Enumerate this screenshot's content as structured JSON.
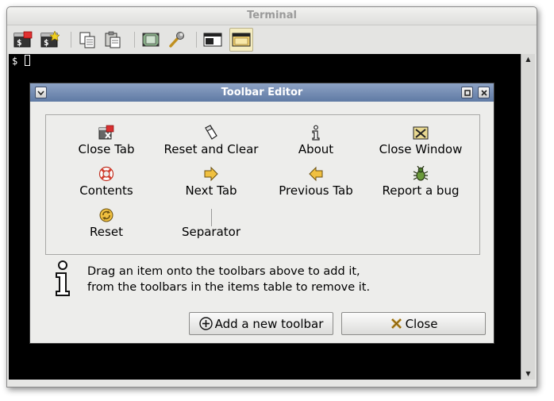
{
  "terminal": {
    "title": "Terminal",
    "prompt": "$",
    "toolbar": {
      "buttons": [
        {
          "name": "new-tab-icon",
          "active": false
        },
        {
          "name": "new-window-icon",
          "active": false
        },
        {
          "name": "copy-icon",
          "active": false
        },
        {
          "name": "paste-icon",
          "active": false
        },
        {
          "name": "fullscreen-icon",
          "active": false
        },
        {
          "name": "wrench-icon",
          "active": false
        },
        {
          "name": "window-icon",
          "active": false
        },
        {
          "name": "toolbar-editor-icon",
          "active": true
        }
      ]
    },
    "scroll_up": "▲",
    "scroll_down": "▼"
  },
  "dialog": {
    "title": "Toolbar Editor",
    "items": [
      {
        "label": "Close Tab",
        "icon": "close-tab-icon"
      },
      {
        "label": "Reset and Clear",
        "icon": "eraser-icon"
      },
      {
        "label": "About",
        "icon": "info-icon"
      },
      {
        "label": "Close Window",
        "icon": "close-window-icon"
      },
      {
        "label": "Contents",
        "icon": "lifebuoy-icon"
      },
      {
        "label": "Next Tab",
        "icon": "arrow-right-icon"
      },
      {
        "label": "Previous Tab",
        "icon": "arrow-left-icon"
      },
      {
        "label": "Report a bug",
        "icon": "bug-icon"
      },
      {
        "label": "Reset",
        "icon": "reset-icon"
      },
      {
        "label": "Separator",
        "icon": "separator-icon"
      }
    ],
    "info_line1": "Drag an item onto the toolbars above to add it,",
    "info_line2": "from the toolbars in the items table to remove it.",
    "add_toolbar_label": "Add a new toolbar",
    "close_label": "Close",
    "colors": {
      "titlebar": "#6f87b0",
      "active_toolbar_button": "#f4ecc0"
    }
  }
}
